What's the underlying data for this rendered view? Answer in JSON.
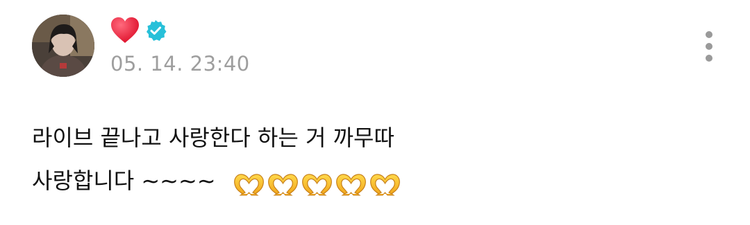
{
  "post": {
    "author": {
      "avatar_icon": "profile-photo",
      "name_emoji": "❤️",
      "verified_icon": "verified-badge-icon",
      "verified_color": "#27c0d9",
      "heart_color": "#e8233c"
    },
    "timestamp": "05. 14. 23:40",
    "more_icon": "more-vertical-icon",
    "body": {
      "line1": "라이브 끝나고 사랑한다 하는 거 까무따",
      "line2": "사랑합니다 ~~~~",
      "emoji": "🫶",
      "emoji_count": 5
    }
  }
}
